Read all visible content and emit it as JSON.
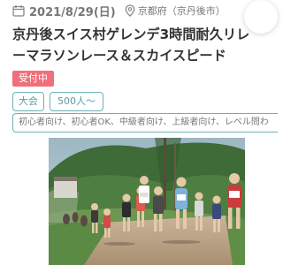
{
  "event": {
    "date": "2021/8/29(日)",
    "location": "京都府（京丹後市）",
    "title": "京丹後スイス村ゲレンデ3時間耐久リレーマラソンレース＆スカイスピード",
    "status_badge": "受付中",
    "tags": [
      "大会",
      "500人～"
    ],
    "levels": "初心者向け、初心者OK、中級者向け、上級者向け、レベル問わ"
  },
  "icons": {
    "date": "calendar-icon",
    "location": "map-pin-icon"
  },
  "colors": {
    "badge": "#ef6f7c",
    "tag_border": "#6db1b7",
    "tag_text": "#5b9ca2"
  }
}
